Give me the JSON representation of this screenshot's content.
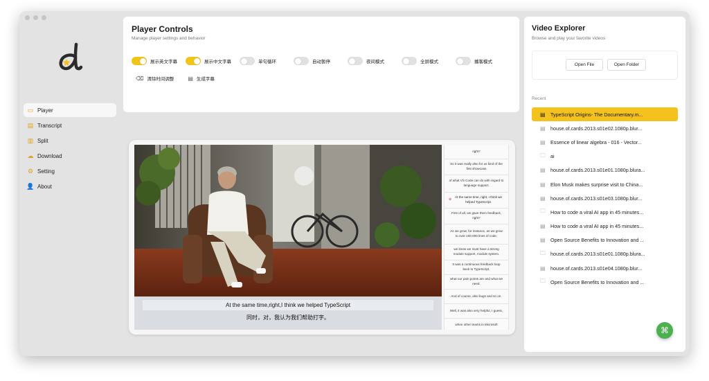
{
  "sidebar": {
    "items": [
      {
        "label": "Player",
        "icon": "video-camera-icon",
        "active": true
      },
      {
        "label": "Transcript",
        "icon": "transcript-icon",
        "active": false
      },
      {
        "label": "Split",
        "icon": "split-icon",
        "active": false
      },
      {
        "label": "Download",
        "icon": "download-icon",
        "active": false
      },
      {
        "label": "Setting",
        "icon": "gear-icon",
        "active": false
      },
      {
        "label": "About",
        "icon": "person-icon",
        "active": false
      }
    ]
  },
  "controls": {
    "title": "Player Controls",
    "subtitle": "Manage player settings and behavior",
    "toggles": [
      {
        "label": "展示英文字幕",
        "on": true
      },
      {
        "label": "展示中文字幕",
        "on": true
      },
      {
        "label": "单句循环",
        "on": false
      },
      {
        "label": "自动暂停",
        "on": false
      },
      {
        "label": "夜间模式",
        "on": false
      },
      {
        "label": "全屏模式",
        "on": false
      },
      {
        "label": "播客模式",
        "on": false
      }
    ],
    "actions": [
      {
        "label": "清除时间调整",
        "icon": "eraser-icon"
      },
      {
        "label": "生成字幕",
        "icon": "subtitle-icon"
      }
    ]
  },
  "player": {
    "subtitle_en": "At the same time,right,I think we helped TypeScript",
    "subtitle_zh": "同时，对，我认为我们帮助打字。",
    "transcript": [
      {
        "text": "right?",
        "active": false
      },
      {
        "text": "So it was really also for us kind of the first showcase",
        "active": false
      },
      {
        "text": "of what VS Code can do with regard to language support.",
        "active": false
      },
      {
        "text": "At the same time, right, I think we helped TypeScript.",
        "active": true
      },
      {
        "text": "First of all, we gave them feedback, right?",
        "active": false
      },
      {
        "text": "As we grow, for instance, as we grow to over 100,000 lines of code,",
        "active": false
      },
      {
        "text": "we knew we must have a strong module support, module system.",
        "active": false
      },
      {
        "text": "It was a continuous feedback loop back to TypeScript,",
        "active": false
      },
      {
        "text": "what our pain points are and what we need.",
        "active": false
      },
      {
        "text": "And of course, also bugs and so on.",
        "active": false
      },
      {
        "text": "Well, it was also very helpful, I guess,",
        "active": false
      },
      {
        "text": "when other teams in Microsoft",
        "active": false
      }
    ]
  },
  "explorer": {
    "title": "Video Explorer",
    "subtitle": "Browse and play your favorite videos",
    "open_file": "Open File",
    "open_folder": "Open Folder",
    "recent_label": "Recent",
    "dot": ".",
    "files": [
      {
        "name": "TypeScript Origins- The Documentary.m...",
        "type": "file",
        "selected": true
      },
      {
        "name": "house.of.cards.2013.s01e02.1080p.blur...",
        "type": "file",
        "selected": false
      },
      {
        "name": "Essence of linear algebra - 016 - Vector...",
        "type": "file",
        "selected": false
      },
      {
        "name": "ai",
        "type": "folder",
        "selected": false
      },
      {
        "name": "house.of.cards.2013.s01e01.1080p.blura...",
        "type": "file",
        "selected": false
      },
      {
        "name": "Elon Musk makes surprise visit to China...",
        "type": "file",
        "selected": false
      },
      {
        "name": "house.of.cards.2013.s01e03.1080p.blur...",
        "type": "file",
        "selected": false
      },
      {
        "name": "How to code a viral AI app in 45 minutes...",
        "type": "folder",
        "selected": false
      },
      {
        "name": "How to code a viral AI app in 45 minutes...",
        "type": "file",
        "selected": false
      },
      {
        "name": "Open Source Benefits to Innovation and ...",
        "type": "file",
        "selected": false
      },
      {
        "name": "house.of.cards.2013.s01e01.1080p.blura...",
        "type": "folder",
        "selected": false
      },
      {
        "name": "house.of.cards.2013.s01e04.1080p.blur...",
        "type": "file",
        "selected": false
      },
      {
        "name": "Open Source Benefits to Innovation and ...",
        "type": "folder",
        "selected": false
      }
    ],
    "fab_icon": "command-icon"
  },
  "colors": {
    "accent": "#f0c419",
    "selected_row": "#f4c21f",
    "fab": "#4caf50",
    "window_bg": "#e3e3e3"
  }
}
